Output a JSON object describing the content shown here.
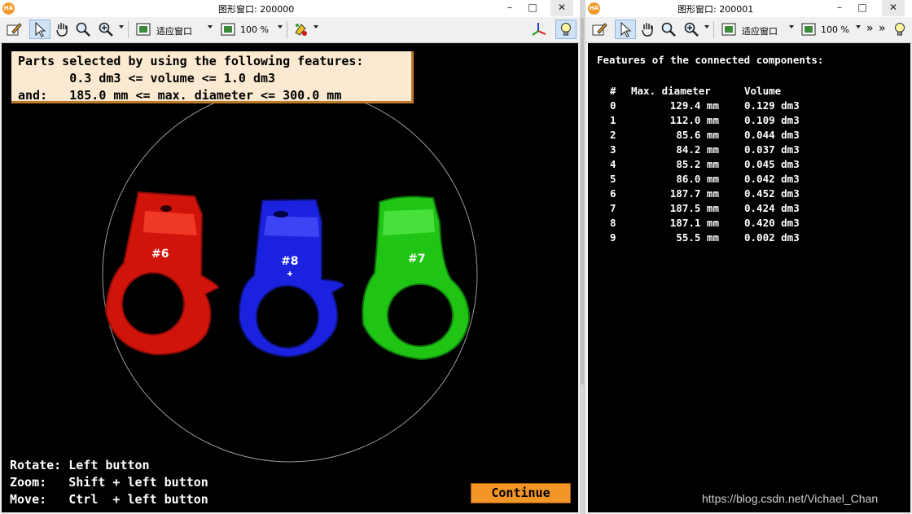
{
  "left_window": {
    "title": "图形窗口: 200000",
    "toolbar": {
      "fit_label": "适应窗口",
      "zoom_label": "100 %"
    },
    "info": {
      "line1": "Parts selected by using the following features:",
      "line2": "       0.3 dm3 <= volume <= 1.0 dm3",
      "line3": "and:   185.0 mm <= max. diameter <= 300.0 mm"
    },
    "parts": [
      {
        "label": "#6",
        "color": "#e21a10"
      },
      {
        "label": "#8",
        "color": "#1c22e8"
      },
      {
        "label": "#7",
        "color": "#22cc16"
      }
    ],
    "help": {
      "line1": "Rotate: Left button",
      "line2": "Zoom:   Shift + left button",
      "line3": "Move:   Ctrl  + left button"
    },
    "continue_label": "Continue"
  },
  "right_window": {
    "title": "图形窗口: 200001",
    "toolbar": {
      "fit_label": "适应窗口",
      "zoom_label": "100 %",
      "overflow_label": "»"
    },
    "heading": "Features of the connected components:",
    "table": {
      "headers": [
        "#",
        "Max. diameter",
        "Volume"
      ],
      "rows": [
        [
          "0",
          "129.4 mm",
          "0.129 dm3"
        ],
        [
          "1",
          "112.0 mm",
          "0.109 dm3"
        ],
        [
          "2",
          "85.6 mm",
          "0.044 dm3"
        ],
        [
          "3",
          "84.2 mm",
          "0.037 dm3"
        ],
        [
          "4",
          "85.2 mm",
          "0.045 dm3"
        ],
        [
          "5",
          "86.0 mm",
          "0.042 dm3"
        ],
        [
          "6",
          "187.7 mm",
          "0.452 dm3"
        ],
        [
          "7",
          "187.5 mm",
          "0.424 dm3"
        ],
        [
          "8",
          "187.1 mm",
          "0.420 dm3"
        ],
        [
          "9",
          "55.5 mm",
          "0.002 dm3"
        ]
      ]
    }
  },
  "watermark": "https://blog.csdn.net/Vichael_Chan",
  "icons": [
    "halcon-app-icon",
    "edit-icon",
    "pointer-icon",
    "hand-pan-icon",
    "magnifier-icon",
    "zoom-in-icon",
    "fit-window-icon",
    "zoom-percent-icon",
    "paint-color-icon",
    "axes-3d-icon",
    "lightbulb-icon",
    "minimize-icon",
    "maximize-icon",
    "close-icon"
  ]
}
